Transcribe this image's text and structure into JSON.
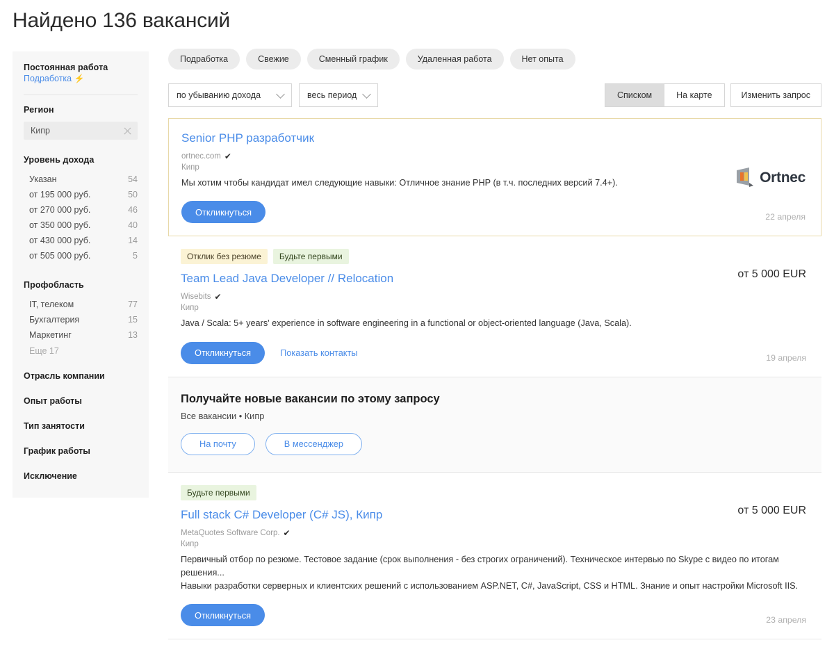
{
  "header": {
    "title": "Найдено 136 вакансий"
  },
  "sidebar": {
    "work_type": {
      "permanent_label": "Постоянная работа",
      "parttime_label": "Подработка",
      "parttime_icon": "lightning-bolt-icon"
    },
    "region": {
      "heading": "Регион",
      "selected": "Кипр",
      "remove_icon": "close-icon"
    },
    "income": {
      "heading": "Уровень дохода",
      "rows": [
        {
          "label": "Указан",
          "count": "54"
        },
        {
          "label": "от 195 000 руб.",
          "count": "50"
        },
        {
          "label": "от 270 000 руб.",
          "count": "46"
        },
        {
          "label": "от 350 000 руб.",
          "count": "40"
        },
        {
          "label": "от 430 000 руб.",
          "count": "14"
        },
        {
          "label": "от 505 000 руб.",
          "count": "5"
        }
      ]
    },
    "profarea": {
      "heading": "Профобласть",
      "rows": [
        {
          "label": "IT, телеком",
          "count": "77"
        },
        {
          "label": "Бухгалтерия",
          "count": "15"
        },
        {
          "label": "Маркетинг",
          "count": "13"
        }
      ],
      "more": "Еще 17"
    },
    "sections": [
      {
        "label": "Отрасль компании"
      },
      {
        "label": "Опыт работы"
      },
      {
        "label": "Тип занятости"
      },
      {
        "label": "График работы"
      },
      {
        "label": "Исключение"
      }
    ]
  },
  "chips": [
    {
      "label": "Подработка"
    },
    {
      "label": "Свежие"
    },
    {
      "label": "Сменный график"
    },
    {
      "label": "Удаленная работа"
    },
    {
      "label": "Нет опыта"
    }
  ],
  "toolbar": {
    "sort_value": "по убыванию дохода",
    "period_value": "весь период",
    "chevron_icon": "chevron-down-icon",
    "view_list": "Списком",
    "view_map": "На карте",
    "edit_query": "Изменить запрос"
  },
  "vacancies": [
    {
      "title": "Senior PHP разработчик",
      "company": "ortnec.com",
      "verified_icon": "verified-check-icon",
      "region": "Кипр",
      "description": "Мы хотим чтобы кандидат имел следующие навыки: Отличное знание PHP (в т.ч. последних версий 7.4+).",
      "apply_label": "Откликнуться",
      "date": "22 апреля",
      "logo_text": "Ortnec",
      "logo_icon": "ortnec-logo-icon"
    },
    {
      "badges": [
        {
          "label": "Отклик без резюме",
          "style": "yellow"
        },
        {
          "label": "Будьте первыми",
          "style": "green"
        }
      ],
      "title": "Team Lead Java Developer // Relocation",
      "company": "Wisebits",
      "verified_icon": "verified-check-icon",
      "region": "Кипр",
      "description": "Java / Scala: 5+ years' experience in software engineering in a functional or object-oriented language (Java, Scala).",
      "apply_label": "Откликнуться",
      "contacts_label": "Показать контакты",
      "salary": "от 5 000 EUR",
      "date": "19 апреля"
    },
    {
      "badges": [
        {
          "label": "Будьте первыми",
          "style": "green"
        }
      ],
      "title": "Full stack C# Developer (C# JS), Кипр",
      "company": "MetaQuotes Software Corp.",
      "verified_icon": "verified-check-icon",
      "region": "Кипр",
      "description_line1": "Первичный отбор по резюме. Тестовое задание (срок выполнения - без строгих ограничений). Техническое интервью по Skype с видео по итогам решения...",
      "description_line2": "Навыки разработки серверных и клиентских решений с использованием ASP.NET, C#, JavaScript, CSS и HTML. Знание и опыт настройки Microsoft IIS.",
      "apply_label": "Откликнуться",
      "salary": "от 5 000 EUR",
      "date": "23 апреля"
    }
  ],
  "promo": {
    "title": "Получайте новые вакансии по этому запросу",
    "subtitle": "Все вакансии • Кипр",
    "email_label": "На почту",
    "messenger_label": "В мессенджер"
  },
  "colors": {
    "accent_blue": "#4a8ce8",
    "featured_border": "#e8d9a8",
    "badge_yellow": "#fbf3d5",
    "badge_green": "#e9f4df"
  }
}
